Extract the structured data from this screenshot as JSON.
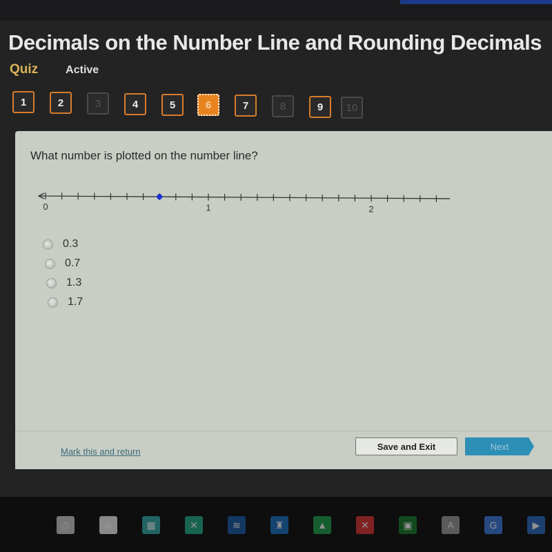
{
  "header": {
    "title": "Decimals on the Number Line and Rounding Decimals",
    "mode": "Quiz",
    "status": "Active"
  },
  "question_nav": [
    {
      "label": "1",
      "state": "answered"
    },
    {
      "label": "2",
      "state": "answered"
    },
    {
      "label": "3",
      "state": "disabled"
    },
    {
      "label": "4",
      "state": "answered"
    },
    {
      "label": "5",
      "state": "answered"
    },
    {
      "label": "6",
      "state": "current"
    },
    {
      "label": "7",
      "state": "answered"
    },
    {
      "label": "8",
      "state": "disabled"
    },
    {
      "label": "9",
      "state": "answered"
    },
    {
      "label": "10",
      "state": "disabled"
    }
  ],
  "question": {
    "prompt": "What number is plotted on the number line?",
    "number_line": {
      "min": 0,
      "max": 2.4,
      "tick_step": 0.1,
      "labels": [
        "0",
        "1",
        "2"
      ],
      "plotted_value": 0.7,
      "point_color": "#1a2fd6"
    },
    "choices": [
      "0.3",
      "0.7",
      "1.3",
      "1.7"
    ]
  },
  "footer": {
    "mark_link": "Mark this and return",
    "save_label": "Save and Exit",
    "next_label": "Next"
  },
  "dock": {
    "icons": [
      "print-add",
      "screencastify",
      "app-grid",
      "butterfly",
      "book",
      "game",
      "google-drive",
      "x-app",
      "google-classroom",
      "truso-apps",
      "google-translate",
      "play"
    ]
  },
  "colors": {
    "accent": "#e8841f",
    "quiz_label": "#d9b35a",
    "next_button": "#2e8fb6"
  }
}
